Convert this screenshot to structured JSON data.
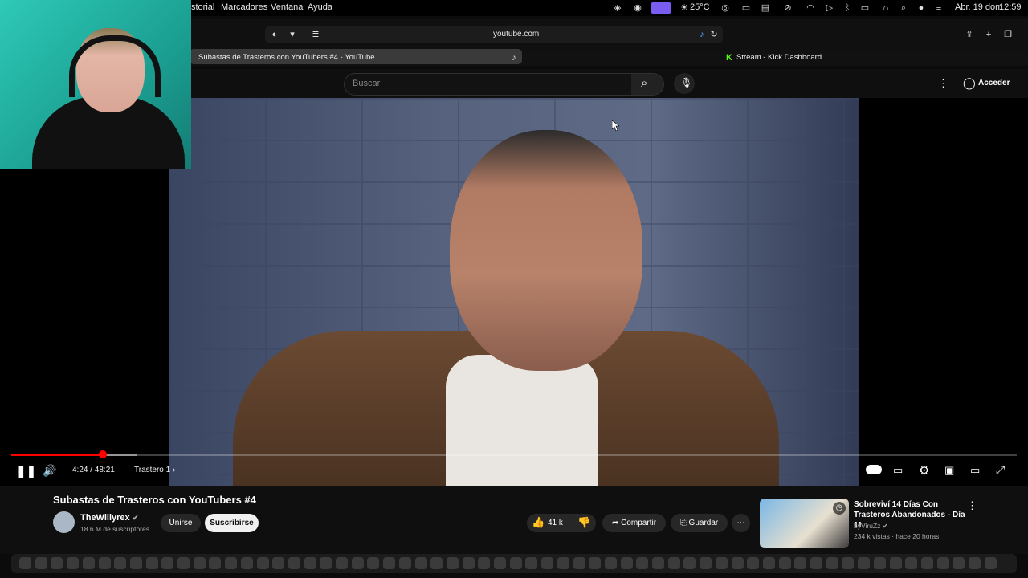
{
  "menubar": {
    "items": [
      "storial",
      "Marcadores",
      "Ventana",
      "Ayuda"
    ],
    "status": {
      "temperature": "25°C",
      "date": "Abr. 19 dom",
      "time": "12:59"
    }
  },
  "browser": {
    "url": "youtube.com",
    "tabs": [
      {
        "label": "Subastas de Trasteros con YouTubers #4 - YouTube"
      },
      {
        "label": "Stream - Kick Dashboard"
      }
    ]
  },
  "youtube": {
    "search_placeholder": "Buscar",
    "sign_in": "Acceder"
  },
  "player": {
    "current_time": "4:24",
    "duration": "48:21",
    "time_display": "4:24 / 48:21",
    "chapter": "Trastero 1",
    "played_fraction": 0.091,
    "buffered_fraction": 0.125,
    "accent": "#ff0000"
  },
  "video": {
    "title": "Subastas de Trasteros con YouTubers #4",
    "channel": "TheWillyrex",
    "subscribers": "18.6 M de suscriptores",
    "join_label": "Unirse",
    "subscribe_label": "Suscribirse",
    "likes": "41 k",
    "share_label": "Compartir",
    "save_label": "Guardar"
  },
  "recommendation": {
    "title": "Sobreviví 14 Días Con Trasteros Abandonados - Día 11",
    "channel": "byViruZz",
    "meta": "234 k vistas · hace 20 horas"
  },
  "icons": {
    "menubar": [
      "steam-icon",
      "discord-icon",
      "stream-icon",
      "weather-icon",
      "record-icon",
      "screen-icon",
      "display-icon",
      "block-icon",
      "wifi-icon",
      "play-icon",
      "bluetooth-icon",
      "battery-icon",
      "headphones-icon",
      "search-icon",
      "siri-icon",
      "control-center-icon"
    ],
    "dock_count": 62
  }
}
